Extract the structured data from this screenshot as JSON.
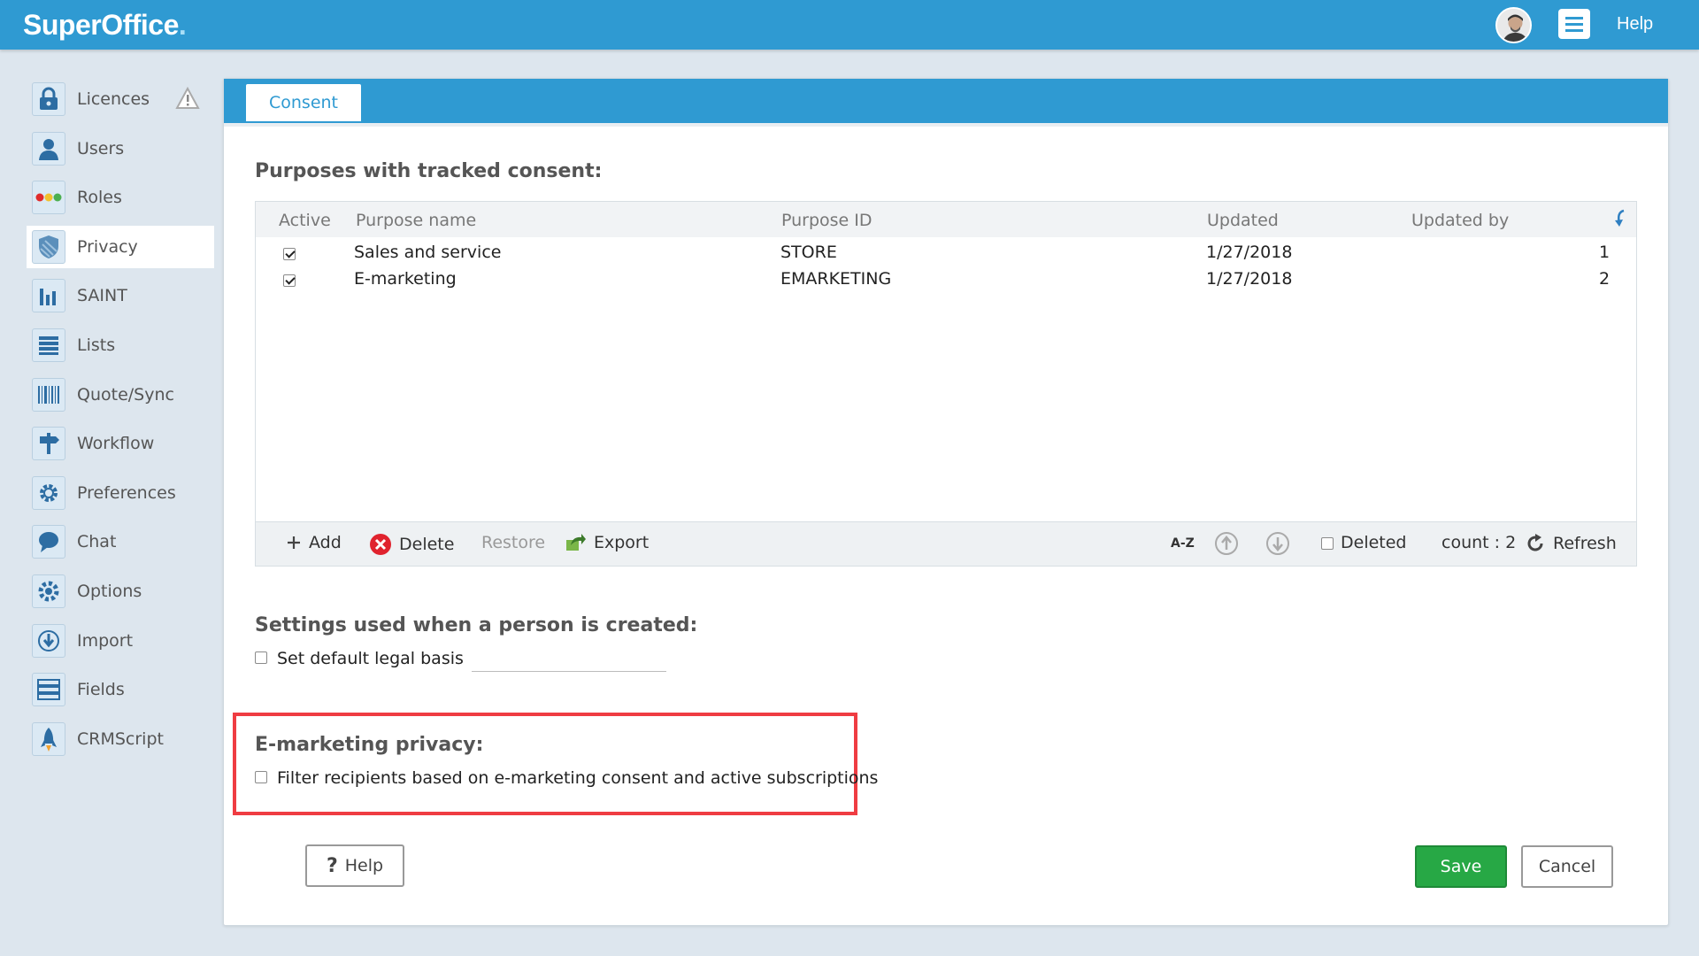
{
  "app": {
    "logo_text": "SuperOffice",
    "logo_dot": "."
  },
  "topbar": {
    "help_label": "Help"
  },
  "sidebar": {
    "items": [
      {
        "label": "Licences",
        "icon": "lock-icon"
      },
      {
        "label": "Users",
        "icon": "user-icon"
      },
      {
        "label": "Roles",
        "icon": "roles-icon"
      },
      {
        "label": "Privacy",
        "icon": "shield-icon",
        "active": true
      },
      {
        "label": "SAINT",
        "icon": "bar-chart-icon"
      },
      {
        "label": "Lists",
        "icon": "list-icon"
      },
      {
        "label": "Quote/Sync",
        "icon": "barcode-icon"
      },
      {
        "label": "Workflow",
        "icon": "signpost-icon"
      },
      {
        "label": "Preferences",
        "icon": "gear-icon"
      },
      {
        "label": "Chat",
        "icon": "chat-bubble-icon"
      },
      {
        "label": "Options",
        "icon": "options-gear-icon"
      },
      {
        "label": "Import",
        "icon": "import-icon"
      },
      {
        "label": "Fields",
        "icon": "fields-icon"
      },
      {
        "label": "CRMScript",
        "icon": "rocket-icon"
      }
    ]
  },
  "panel": {
    "tab_label": "Consent",
    "purposes_title": "Purposes with tracked consent:",
    "columns": [
      "Active",
      "Purpose name",
      "Purpose ID",
      "Updated",
      "Updated by"
    ],
    "rows": [
      {
        "active": true,
        "name": "Sales and service",
        "id": "STORE",
        "updated": "1/27/2018",
        "updated_by": "1"
      },
      {
        "active": true,
        "name": "E-marketing",
        "id": "EMARKETING",
        "updated": "1/27/2018",
        "updated_by": "2"
      }
    ],
    "toolbar": {
      "add": "Add",
      "delete": "Delete",
      "restore": "Restore",
      "export": "Export",
      "sort_label": "A-Z",
      "deleted": "Deleted",
      "count": "count : 2",
      "refresh": "Refresh"
    },
    "settings_title": "Settings used when a person is created:",
    "default_legal_basis": "Set default legal basis",
    "emarketing_title": "E-marketing privacy:",
    "filter_recipients": "Filter recipients based on e-marketing consent and active subscriptions",
    "buttons": {
      "help": "Help",
      "help_glyph": "?",
      "save": "Save",
      "cancel": "Cancel"
    }
  },
  "colors": {
    "primary": "#2f9ad2",
    "save": "#27a845",
    "highlight": "#ef3c42",
    "delete": "#e0232e"
  }
}
